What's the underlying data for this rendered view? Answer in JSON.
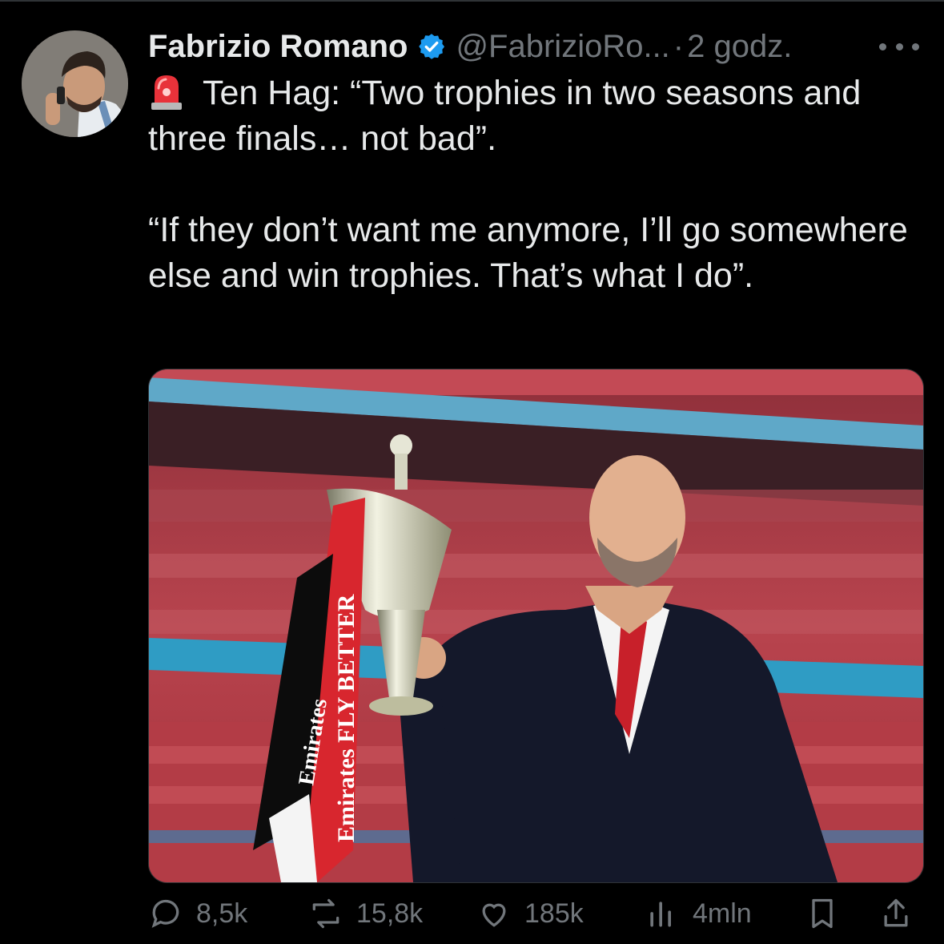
{
  "author": {
    "name": "Fabrizio Romano",
    "handle": "@FabrizioRo...",
    "separator": "·",
    "time": "2 godz."
  },
  "tweet": {
    "emoji": "siren-icon",
    "line1": "Ten Hag: “Two trophies in two seasons and three finals… not bad”.",
    "line2": "“If they don’t want me anymore, I’ll go somewhere else and win trophies. That’s what I do”."
  },
  "media": {
    "ribbon_text_1": "Emirates FLY BETTER",
    "ribbon_text_2": "Emirates"
  },
  "actions": {
    "replies": "8,5k",
    "reposts": "15,8k",
    "likes": "185k",
    "views": "4mln"
  },
  "colors": {
    "background": "#000000",
    "text": "#e7e9ea",
    "secondary": "#71767b",
    "verified": "#1d9bf0"
  }
}
